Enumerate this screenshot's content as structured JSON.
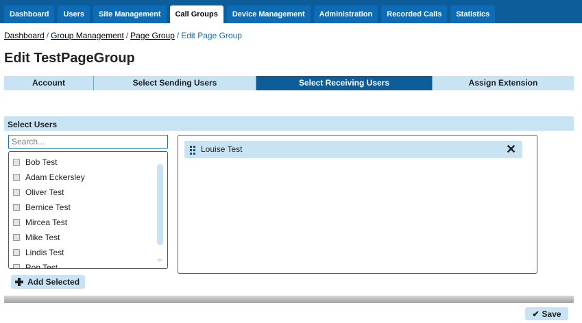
{
  "nav": {
    "tabs": [
      {
        "label": "Dashboard"
      },
      {
        "label": "Users"
      },
      {
        "label": "Site Management"
      },
      {
        "label": "Call Groups"
      },
      {
        "label": "Device Management"
      },
      {
        "label": "Administration"
      },
      {
        "label": "Recorded Calls"
      },
      {
        "label": "Statistics"
      }
    ],
    "active": "Call Groups"
  },
  "breadcrumb": {
    "items": [
      "Dashboard",
      "Group Management",
      "Page Group"
    ],
    "current": "Edit Page Group",
    "separator": "/"
  },
  "page_title": "Edit TestPageGroup",
  "steps": [
    {
      "label": "Account"
    },
    {
      "label": "Select Sending Users"
    },
    {
      "label": "Select Receiving Users"
    },
    {
      "label": "Assign Extension"
    }
  ],
  "panel": {
    "title": "Select Users",
    "search_placeholder": "Search...",
    "users": [
      "Bob Test",
      "Adam Eckersley",
      "Oliver Test",
      "Bernice Test",
      "Mircea Test",
      "Mike Test",
      "Lindis Test",
      "Ron Test"
    ],
    "selected": [
      {
        "name": "Louise Test"
      }
    ],
    "add_label": "Add Selected"
  },
  "save_label": "Save",
  "colors": {
    "nav_bg": "#0d5d9a",
    "tab_bg": "#0d6cb5",
    "light_blue": "#c8e3f4",
    "link_blue": "#0d6cb5"
  }
}
